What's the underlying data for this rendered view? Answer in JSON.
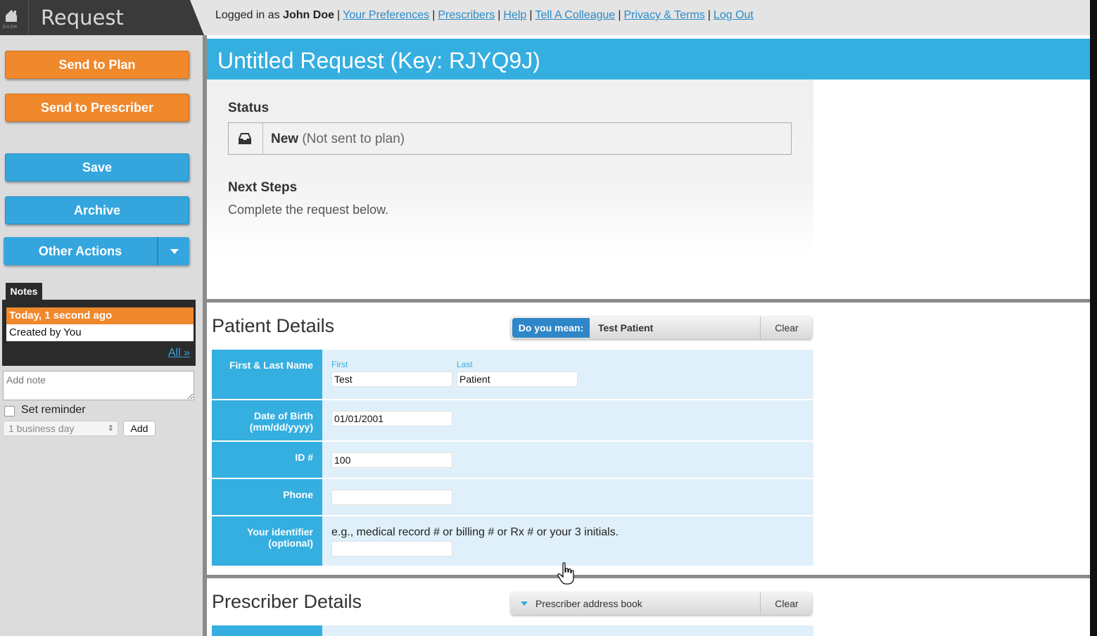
{
  "app": {
    "title": "Request",
    "brand_small": "DASH"
  },
  "userbar": {
    "prefix": "Logged in as",
    "user": "John Doe",
    "links": [
      "Your Preferences",
      "Prescribers",
      "Help",
      "Tell A Colleague",
      "Privacy & Terms",
      "Log Out"
    ]
  },
  "sidebar": {
    "send_to_plan": "Send to Plan",
    "send_to_prescriber": "Send to Prescriber",
    "save": "Save",
    "archive": "Archive",
    "other_actions": "Other Actions",
    "notes_tab": "Notes",
    "note_date": "Today, 1 second ago",
    "note_text": "Created by You",
    "notes_all": "All »",
    "add_note_placeholder": "Add note",
    "set_reminder": "Set reminder",
    "reminder_value": "1 business day",
    "add_button": "Add"
  },
  "request": {
    "title": "Untitled Request (Key: RJYQ9J)",
    "status_heading": "Status",
    "status_value": "New",
    "status_note": "(Not sent to plan)",
    "next_steps_heading": "Next Steps",
    "next_steps_text": "Complete the request below."
  },
  "patient": {
    "heading": "Patient Details",
    "do_you_mean_label": "Do you mean:",
    "do_you_mean_value": "Test Patient",
    "clear": "Clear",
    "labels": {
      "name": "First & Last Name",
      "dob_1": "Date of Birth",
      "dob_2": "(mm/dd/yyyy)",
      "id": "ID #",
      "phone": "Phone",
      "identifier_1": "Your identifier",
      "identifier_2": "(optional)"
    },
    "first_sub": "First",
    "last_sub": "Last",
    "first_value": "Test",
    "last_value": "Patient",
    "dob_value": "01/01/2001",
    "id_value": "100",
    "phone_value": "",
    "identifier_hint": "e.g., medical record # or billing # or Rx # or your 3 initials.",
    "identifier_value": ""
  },
  "prescriber": {
    "heading": "Prescriber Details",
    "address_book": "Prescriber address book",
    "clear": "Clear"
  },
  "colors": {
    "accent_blue": "#35aee0",
    "button_orange": "#f0882c",
    "link_blue": "#2a8bc9"
  }
}
